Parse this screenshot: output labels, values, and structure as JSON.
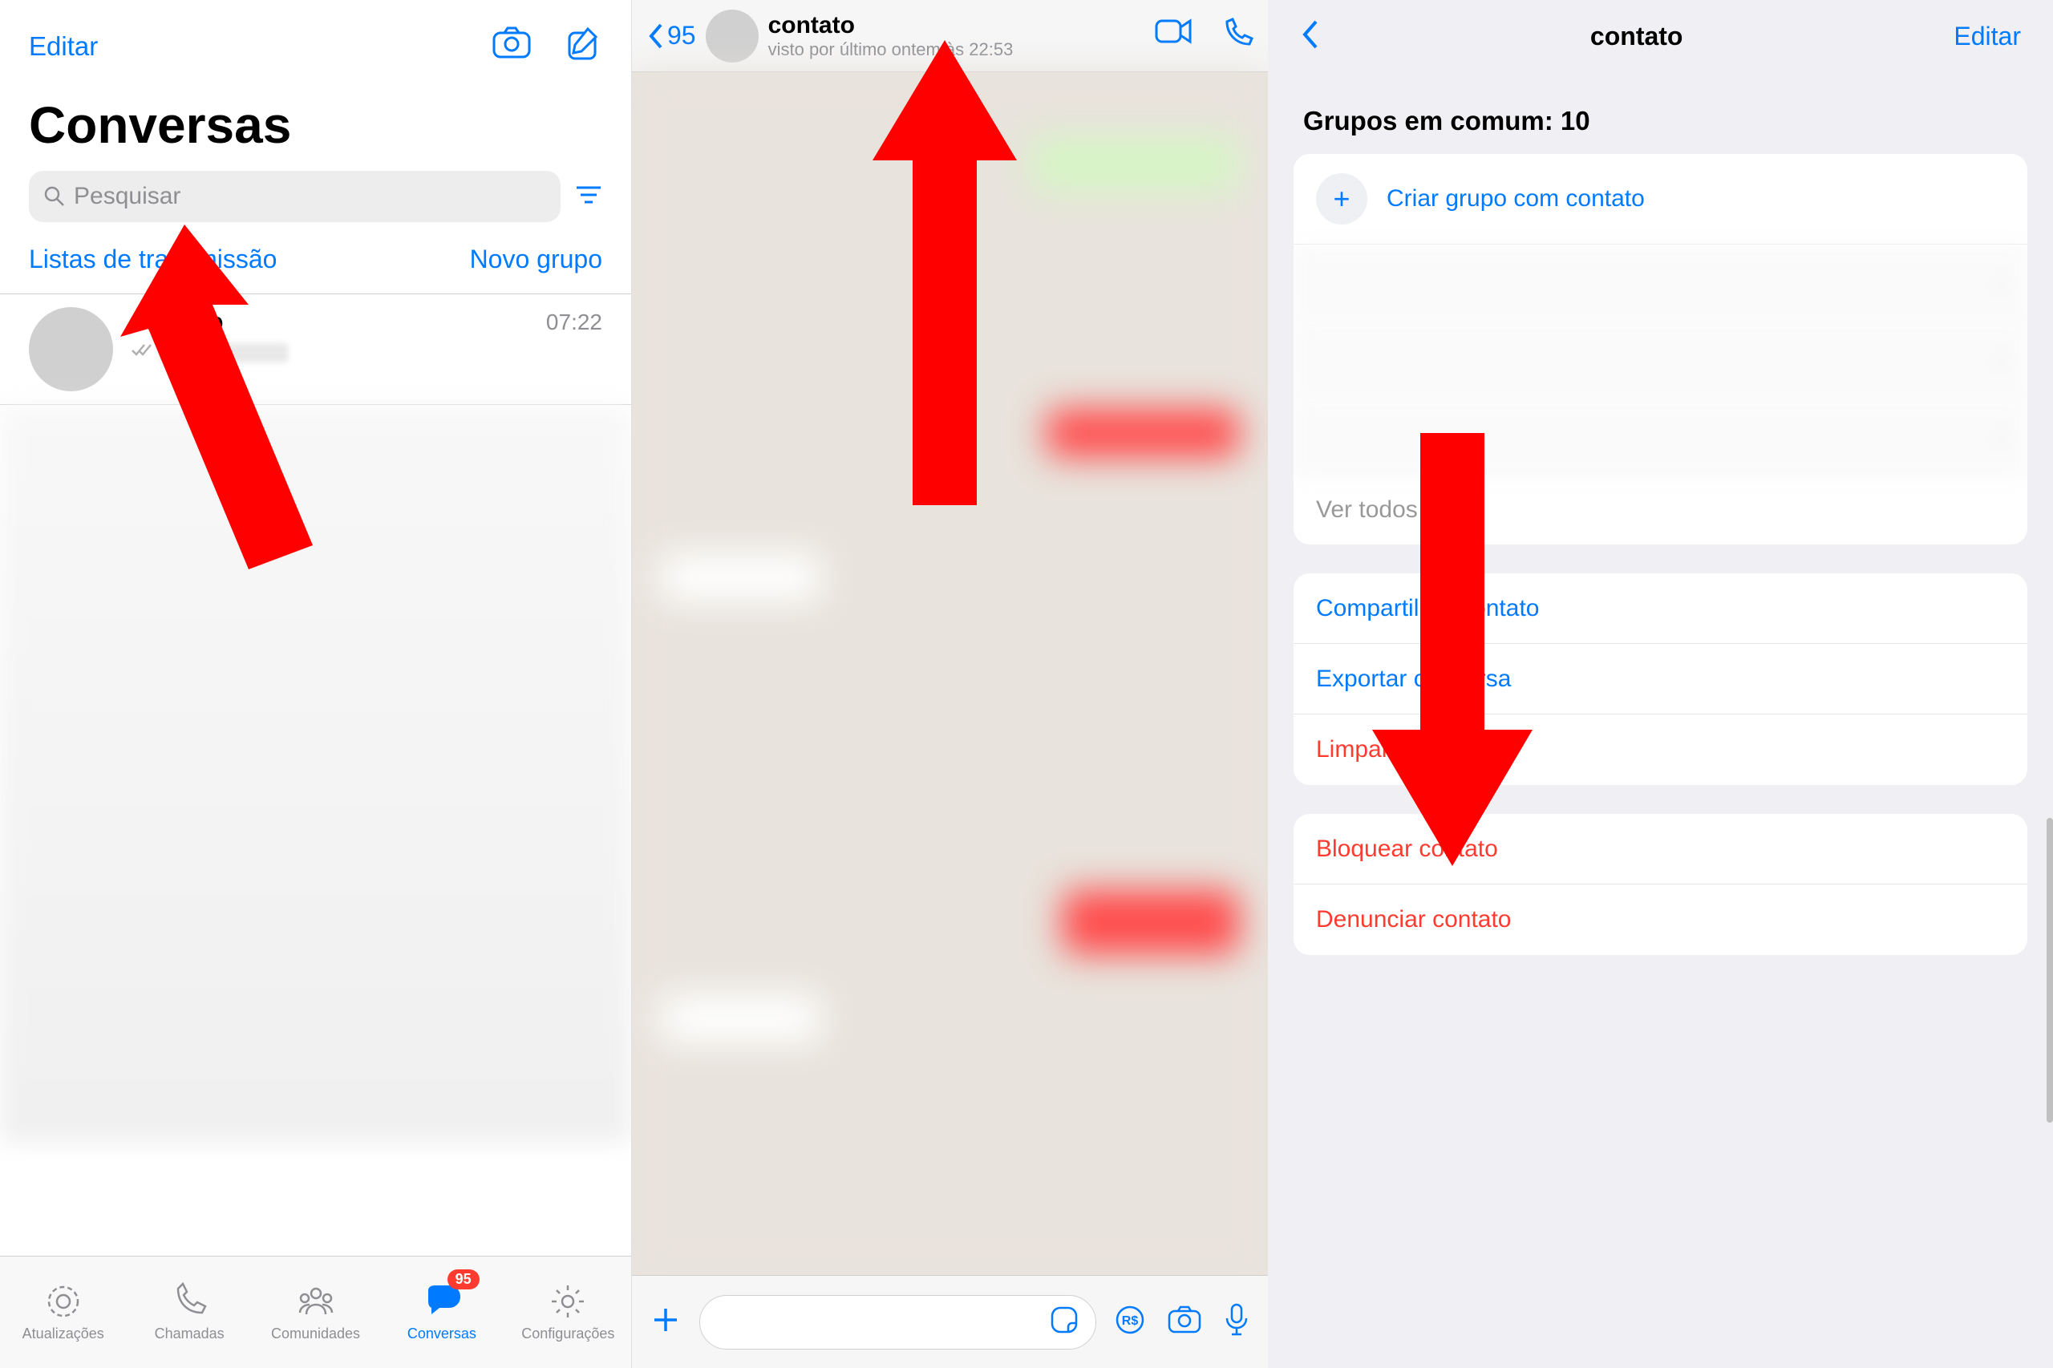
{
  "panel1": {
    "edit": "Editar",
    "title": "Conversas",
    "search_placeholder": "Pesquisar",
    "broadcast_link": "Listas de transmissão",
    "new_group": "Novo grupo",
    "chat": {
      "name": "contato",
      "time": "07:22"
    },
    "tabs": {
      "updates": "Atualizações",
      "calls": "Chamadas",
      "communities": "Comunidades",
      "chats": "Conversas",
      "settings": "Configurações",
      "badge": "95"
    }
  },
  "panel2": {
    "back_count": "95",
    "name": "contato",
    "last_seen": "visto por último ontem às 22:53"
  },
  "panel3": {
    "title": "contato",
    "edit": "Editar",
    "groups_title": "Grupos em comum: 10",
    "create_group": "Criar grupo com contato",
    "see_all": "Ver todos",
    "share": "Compartilhar contato",
    "export": "Exportar conversa",
    "clear": "Limpar conversa",
    "block": "Bloquear contato",
    "report": "Denunciar contato"
  }
}
